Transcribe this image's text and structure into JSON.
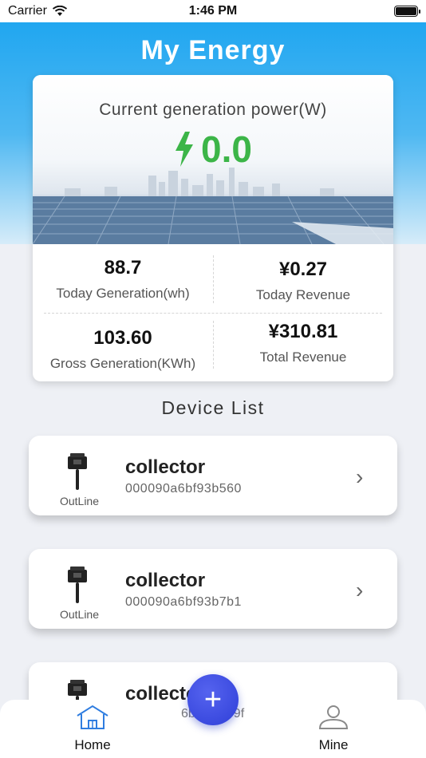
{
  "status_bar": {
    "carrier": "Carrier",
    "time": "1:46 PM"
  },
  "page": {
    "title": "My Energy"
  },
  "power": {
    "label": "Current generation power(W)",
    "value": "0.0"
  },
  "stats": {
    "today_generation": {
      "value": "88.7",
      "label": "Today Generation(wh)"
    },
    "today_revenue": {
      "value": "¥0.27",
      "label": "Today Revenue"
    },
    "gross_generation": {
      "value": "103.60",
      "label": "Gross Generation(KWh)"
    },
    "total_revenue": {
      "value": "¥310.81",
      "label": "Total Revenue"
    }
  },
  "device_list": {
    "title": "Device List",
    "devices": [
      {
        "name": "collector",
        "serial": "000090a6bf93b560",
        "status": "OutLine"
      },
      {
        "name": "collector",
        "serial": "000090a6bf93b7b1",
        "status": "OutLine"
      },
      {
        "name": "collector",
        "serial": "6b",
        "serial_tail": "9f"
      }
    ]
  },
  "tabbar": {
    "home_label": "Home",
    "mine_label": "Mine",
    "add_symbol": "+"
  },
  "colors": {
    "accent_blue": "#1aa3f0",
    "power_green": "#3cb548",
    "fab_blue": "#3a48e0"
  }
}
